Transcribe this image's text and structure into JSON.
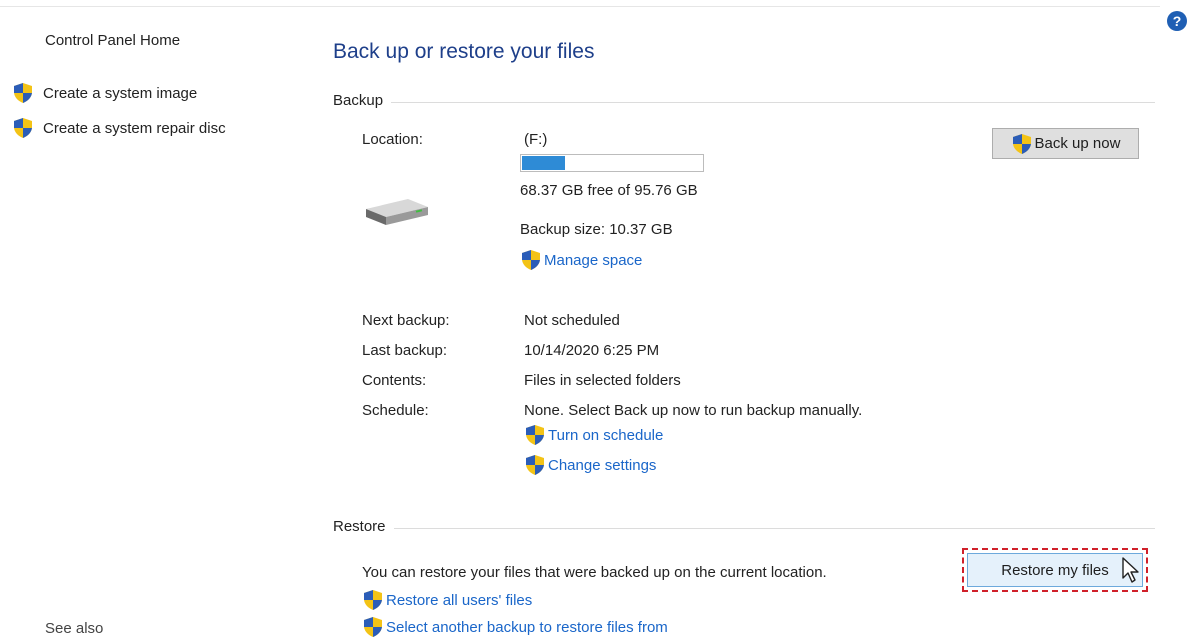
{
  "sidebar": {
    "home": "Control Panel Home",
    "links": [
      {
        "label": "Create a system image",
        "icon": "shield-icon"
      },
      {
        "label": "Create a system repair disc",
        "icon": "shield-icon"
      }
    ],
    "partial_label": "See also"
  },
  "header": {
    "title": "Back up or restore your files",
    "help_icon": "help-icon"
  },
  "backup": {
    "section_label": "Backup",
    "location_label": "Location:",
    "location_value": "(F:)",
    "free_space_text": "68.37 GB free of 95.76 GB",
    "used_fraction": 0.24,
    "backup_size_text": "Backup size: 10.37 GB",
    "manage_space_link": "Manage space",
    "back_up_now_button": "Back up now",
    "details": [
      {
        "label": "Next backup:",
        "value": "Not scheduled"
      },
      {
        "label": "Last backup:",
        "value": "10/14/2020 6:25 PM"
      },
      {
        "label": "Contents:",
        "value": "Files in selected folders"
      },
      {
        "label": "Schedule:",
        "value": "None. Select Back up now to run backup manually."
      }
    ],
    "turn_on_schedule_link": "Turn on schedule",
    "change_settings_link": "Change settings"
  },
  "restore": {
    "section_label": "Restore",
    "description": "You can restore your files that were backed up on the current location.",
    "restore_my_files_button": "Restore my files",
    "restore_all_users_link": "Restore all users' files",
    "select_another_backup_link": "Select another backup to restore files from"
  },
  "colors": {
    "title_blue": "#1e3f8a",
    "link_blue": "#1a66c9",
    "progress_blue": "#2e8bd6",
    "highlight_red": "#d0202a"
  }
}
